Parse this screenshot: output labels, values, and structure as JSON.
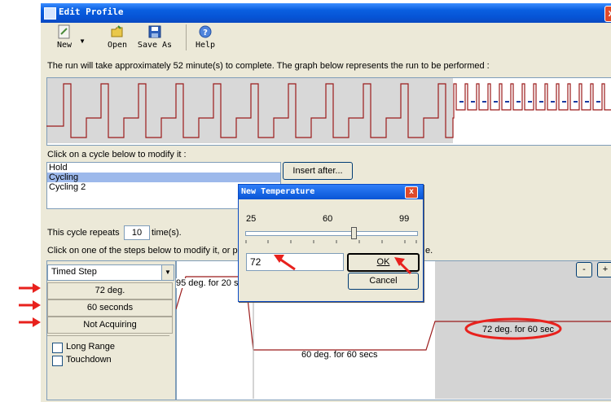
{
  "window": {
    "title": "Edit Profile",
    "close_glyph": "x"
  },
  "toolbar": {
    "new_label": "New",
    "open_label": "Open",
    "saveas_label": "Save As",
    "help_label": "Help"
  },
  "info_text": "The run will take approximately 52 minute(s) to complete. The graph below represents the run to be performed :",
  "cycle_section": {
    "prompt": "Click on a cycle below to modify it :",
    "items": [
      "Hold",
      "Cycling",
      "Cycling 2"
    ],
    "selected_index": 1,
    "insert_after_label": "Insert after..."
  },
  "repeats": {
    "prefix": "This cycle repeats",
    "value": "10",
    "suffix": "time(s)."
  },
  "steps_prompt_start": "Click on one of the steps below to modify it, or pr",
  "steps_prompt_end": "e.",
  "step_panel": {
    "step_type": "Timed Step",
    "temperature": "72 deg.",
    "duration": "60 seconds",
    "acquiring": "Not Acquiring",
    "long_range": "Long Range",
    "touchdown": "Touchdown"
  },
  "steps_graph": {
    "step1": "95 deg. for 20 s",
    "step2": "60 deg. for 60 secs",
    "step3": "72 deg. for 60 sec",
    "minus_label": "-",
    "plus_label": "+"
  },
  "dialog": {
    "title": "New Temperature",
    "close_glyph": "x",
    "slider_min": "25",
    "slider_mid": "60",
    "slider_max": "99",
    "slider_value": 72,
    "input_value": "72",
    "ok_label": "OK",
    "cancel_label": "Cancel"
  },
  "colors": {
    "trace": "#9b1b1b",
    "annotation_red": "#e8211d",
    "selection": "#9db9eb",
    "titlebar": "#0a5fe0"
  }
}
